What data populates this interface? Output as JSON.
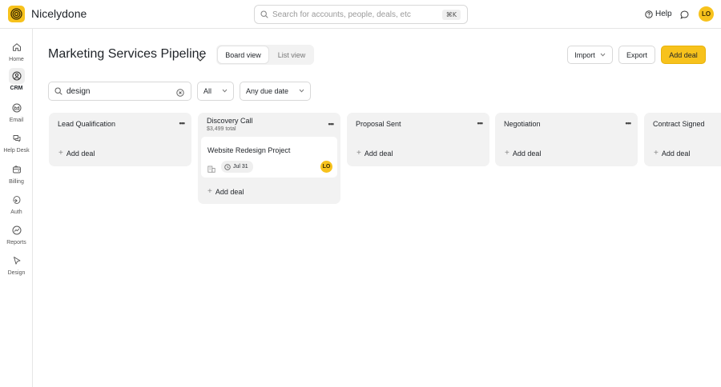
{
  "app": {
    "name": "Nicelydone"
  },
  "topbar": {
    "search_placeholder": "Search for accounts, people, deals, etc",
    "search_shortcut": "⌘K",
    "help_label": "Help",
    "user_initials": "LO"
  },
  "sidebar": {
    "items": [
      {
        "label": "Home",
        "icon": "home-icon",
        "active": false
      },
      {
        "label": "CRM",
        "icon": "crm-icon",
        "active": true
      },
      {
        "label": "Email",
        "icon": "email-icon",
        "active": false
      },
      {
        "label": "Help Desk",
        "icon": "help-desk-icon",
        "active": false
      },
      {
        "label": "Billing",
        "icon": "billing-icon",
        "active": false
      },
      {
        "label": "Auth",
        "icon": "auth-icon",
        "active": false
      },
      {
        "label": "Reports",
        "icon": "reports-icon",
        "active": false
      },
      {
        "label": "Design",
        "icon": "design-icon",
        "active": false
      }
    ]
  },
  "header": {
    "title": "Marketing Services Pipeline",
    "views": {
      "board": "Board view",
      "list": "List view",
      "active": "board"
    },
    "import_label": "Import",
    "export_label": "Export",
    "add_deal_label": "Add deal"
  },
  "filters": {
    "search_value": "design",
    "owner_filter": "All",
    "due_date_filter": "Any due date"
  },
  "board": {
    "add_deal_label": "Add deal",
    "columns": [
      {
        "title": "Lead Qualification",
        "subtitle": "",
        "deals": []
      },
      {
        "title": "Discovery Call",
        "subtitle": "$3,499 total",
        "deals": [
          {
            "title": "Website Redesign Project",
            "due": "Jul 31",
            "owner_initials": "LO"
          }
        ]
      },
      {
        "title": "Proposal Sent",
        "subtitle": "",
        "deals": []
      },
      {
        "title": "Negotiation",
        "subtitle": "",
        "deals": []
      },
      {
        "title": "Contract Signed",
        "subtitle": "",
        "deals": []
      }
    ]
  },
  "colors": {
    "accent": "#f7c21c",
    "column_bg": "#f2f2f2",
    "border": "#d8d8d8"
  }
}
